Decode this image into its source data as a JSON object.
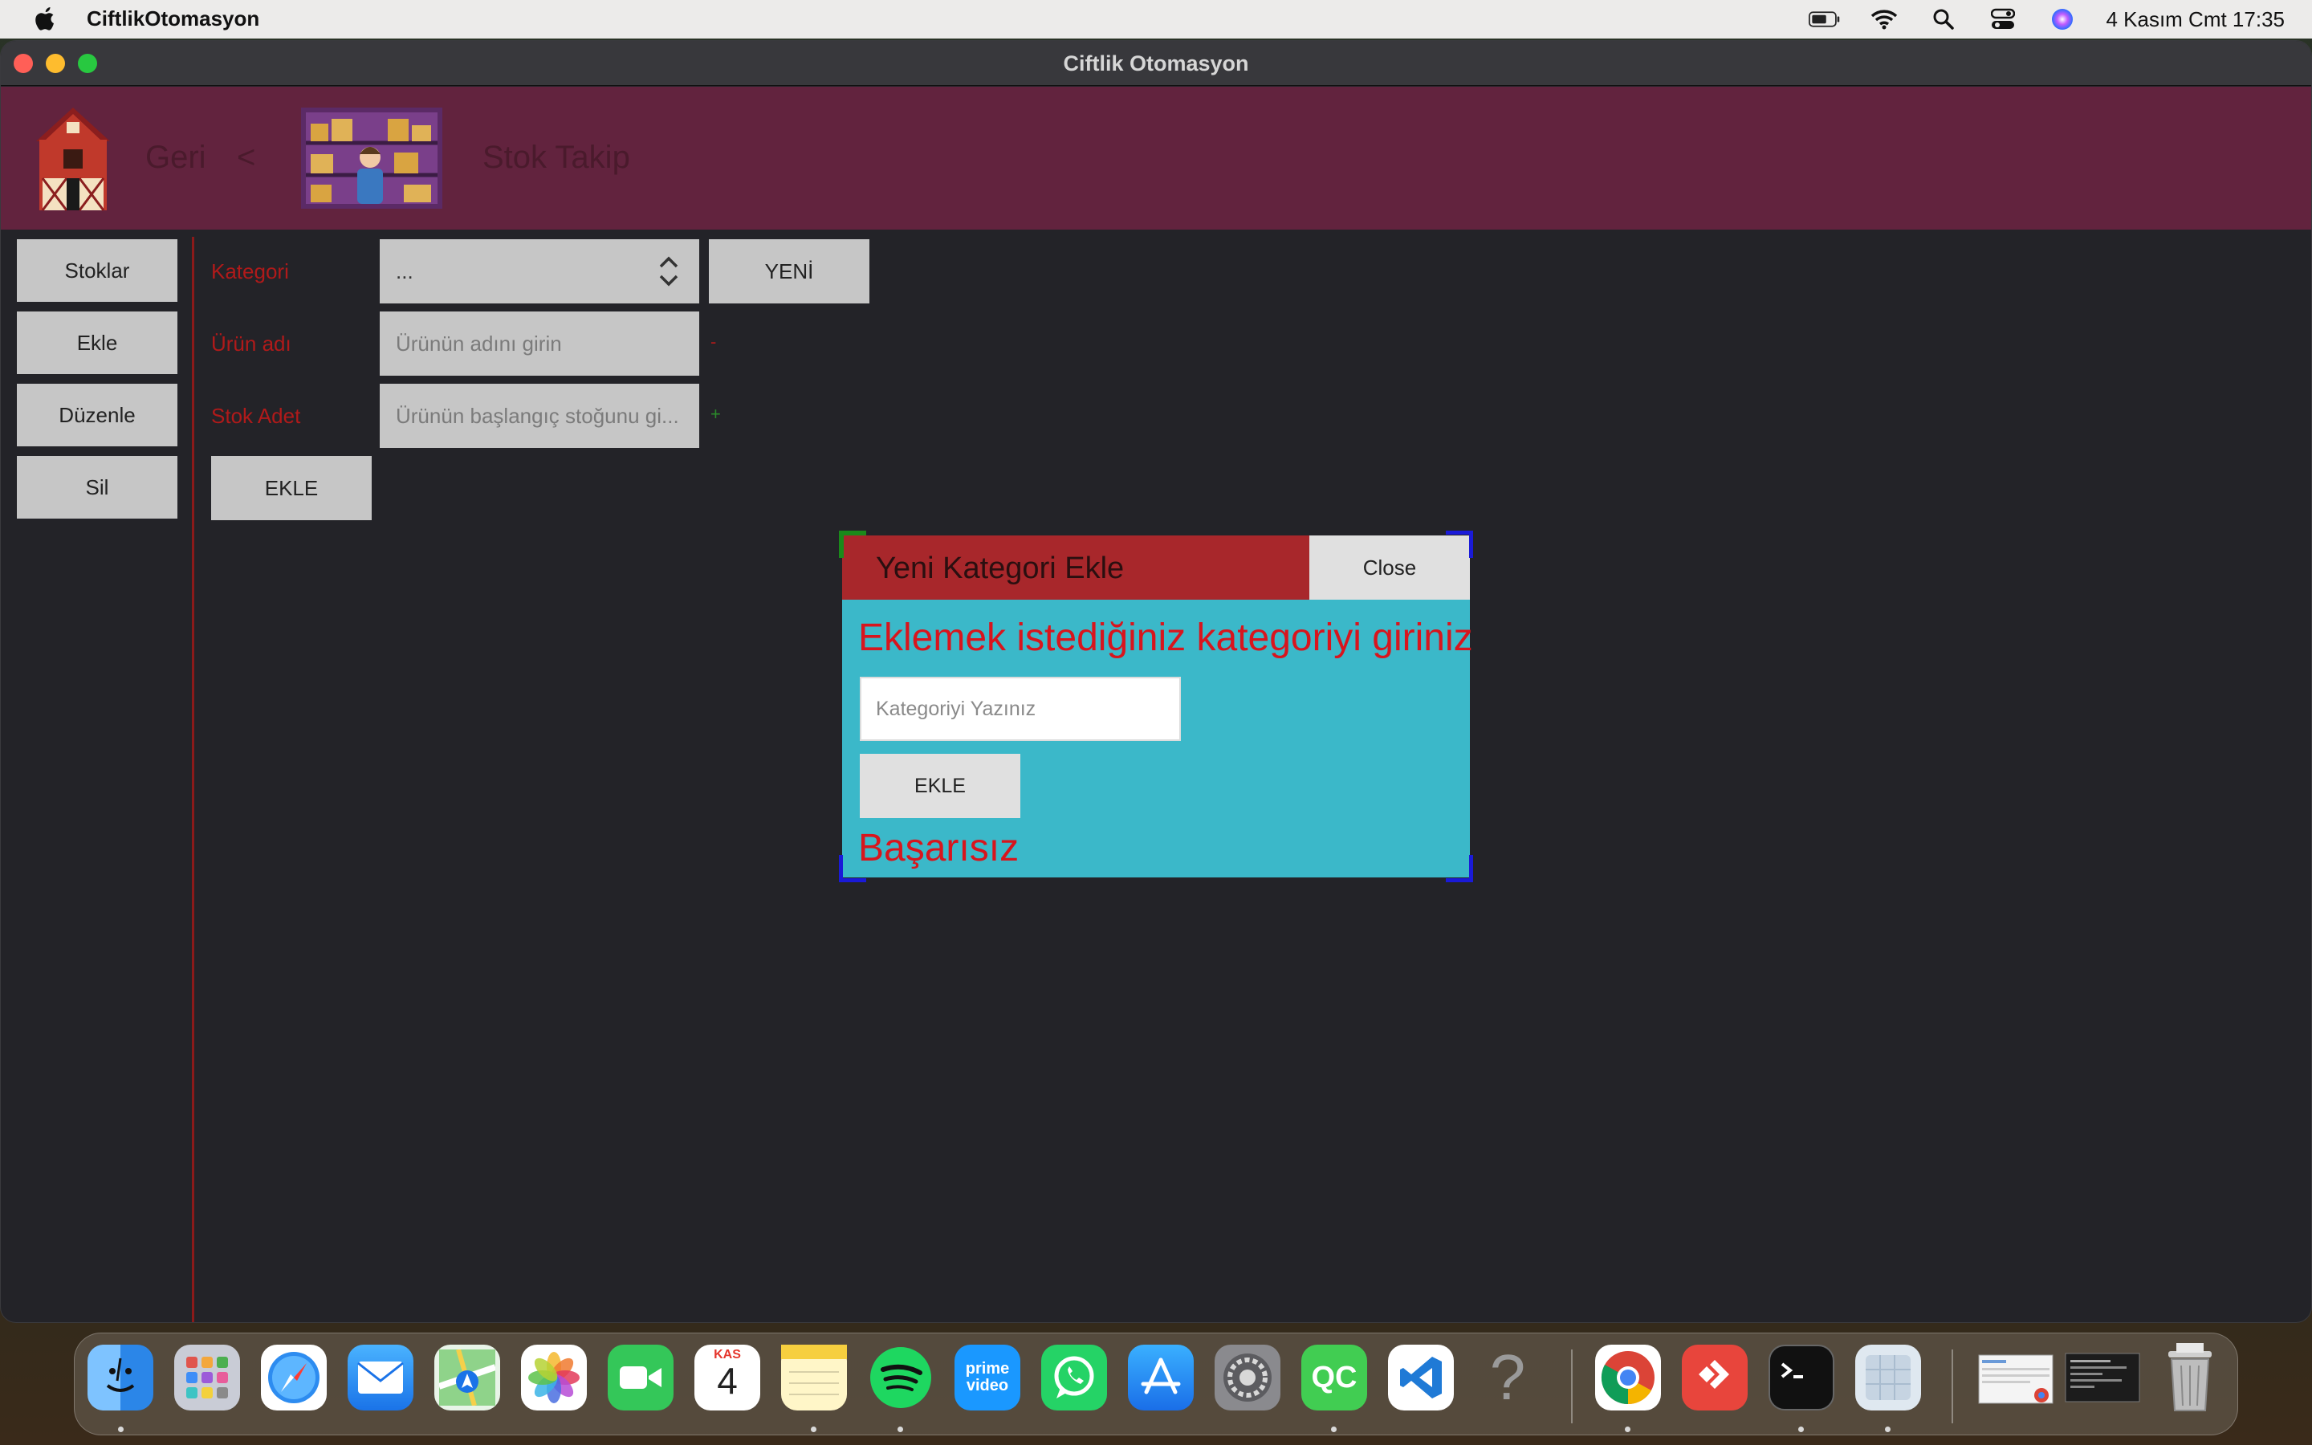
{
  "menubar": {
    "app_name": "CiftlikOtomasyon",
    "datetime": "4 Kasım Cmt  17:35"
  },
  "window": {
    "title": "Ciftlik Otomasyon"
  },
  "header": {
    "back_label": "Geri",
    "back_arrow": "<",
    "page_title": "Stok Takip"
  },
  "sidebar": {
    "items": [
      {
        "label": "Stoklar"
      },
      {
        "label": "Ekle"
      },
      {
        "label": "Düzenle"
      },
      {
        "label": "Sil"
      }
    ]
  },
  "form": {
    "category_label": "Kategori",
    "category_value": "...",
    "new_button": "YENİ",
    "product_label": "Ürün adı",
    "product_placeholder": "Ürünün adını girin",
    "stock_label": "Stok Adet",
    "stock_placeholder": "Ürünün başlangıç stoğunu gi...",
    "minus_mark": "-",
    "plus_mark": "+",
    "add_button": "EKLE"
  },
  "dialog": {
    "title": "Yeni Kategori Ekle",
    "close_label": "Close",
    "prompt": "Eklemek istediğiniz kategoriyi giriniz",
    "input_placeholder": "Kategoriyi Yazınız",
    "add_button": "EKLE",
    "status": "Başarısız"
  },
  "dock": {
    "calendar_month": "KAS",
    "calendar_day": "4",
    "prime_line1": "prime",
    "prime_line2": "video",
    "qc_label": "QC",
    "help_glyph": "?"
  },
  "colors": {
    "header_bg": "#62233e",
    "window_bg": "#232328",
    "label_red": "#b01a1a",
    "dialog_bg": "#3bb8c9",
    "dialog_head": "#a8272b",
    "dialog_text_red": "#d8151d"
  }
}
